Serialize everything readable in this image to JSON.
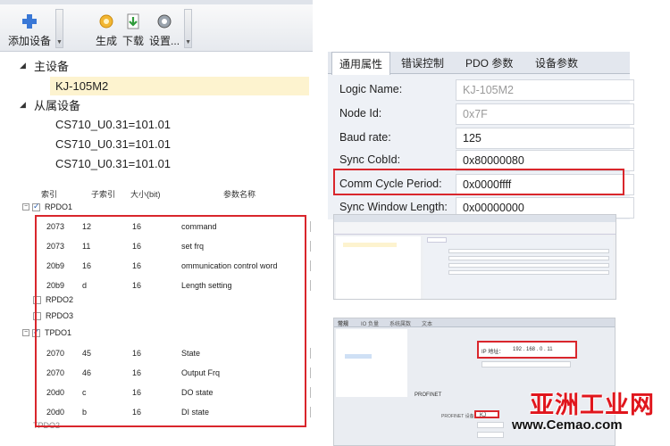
{
  "toolbar": {
    "add_device": "添加设备",
    "generate": "生成",
    "download": "下载",
    "settings": "设置..."
  },
  "tree": {
    "master_label": "主设备",
    "master_device": "KJ-105M2",
    "slave_label": "从属设备",
    "slaves": [
      "CS710_U0.31=101.01",
      "CS710_U0.31=101.01",
      "CS710_U0.31=101.01"
    ]
  },
  "properties": {
    "tabs": [
      "通用属性",
      "错误控制",
      "PDO 参数",
      "设备参数"
    ],
    "rows": [
      {
        "label": "Logic Name:",
        "value": "KJ-105M2"
      },
      {
        "label": "Node Id:",
        "value": "0x7F"
      },
      {
        "label": "Baud rate:",
        "value": "125"
      },
      {
        "label": "Sync CobId:",
        "value": "0x80000080"
      },
      {
        "label": "Comm Cycle Period:",
        "value": "0x0000ffff"
      },
      {
        "label": "Sync Window Length:",
        "value": "0x00000000"
      }
    ]
  },
  "pdo": {
    "headers": [
      "索引",
      "子索引",
      "大小(bit)",
      "参数名称"
    ],
    "groups": {
      "rpdo1": "RPDO1",
      "rpdo2": "RPDO2",
      "rpdo3": "RPDO3",
      "tpdo1": "TPDO1",
      "tpdo2": "TPDO2"
    },
    "rpdo_rows": [
      {
        "index": "2073",
        "sub": "12",
        "size": "16",
        "name": "command"
      },
      {
        "index": "2073",
        "sub": "11",
        "size": "16",
        "name": "set frq"
      },
      {
        "index": "20b9",
        "sub": "16",
        "size": "16",
        "name": "ommunication control word"
      },
      {
        "index": "20b9",
        "sub": "d",
        "size": "16",
        "name": "Length setting"
      }
    ],
    "tpdo_rows": [
      {
        "index": "2070",
        "sub": "45",
        "size": "16",
        "name": "State"
      },
      {
        "index": "2070",
        "sub": "46",
        "size": "16",
        "name": "Output Frq"
      },
      {
        "index": "20d0",
        "sub": "c",
        "size": "16",
        "name": "DO state"
      },
      {
        "index": "20d0",
        "sub": "b",
        "size": "16",
        "name": "DI state"
      }
    ]
  },
  "shot2": {
    "tabs": [
      "常规",
      "IO 负量",
      "系统属数",
      "文本"
    ],
    "profinet": "PROFINET",
    "ip_label": "IP 地址：",
    "ip_value": "192 . 168 . 0 . 11",
    "device_name_label": "PROFINET 设备名称",
    "device_name_value": "KJ"
  },
  "watermark": {
    "title": "亚洲工业网",
    "url": "www.Cemao.com"
  },
  "colors": {
    "highlight_red": "#d9262c",
    "selection": "#fdf3cf",
    "watermark_red": "#e0161d"
  }
}
